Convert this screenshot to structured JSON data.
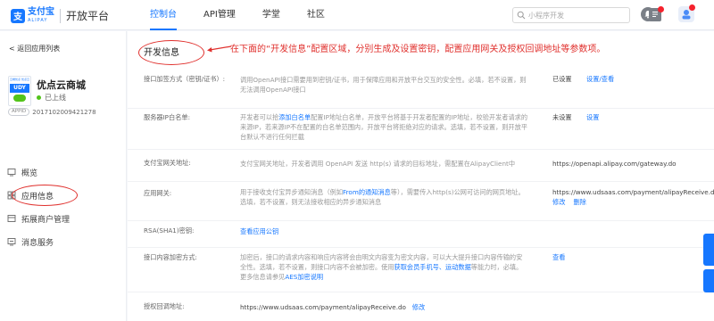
{
  "brand": {
    "mark": "支",
    "name_cn": "支付宝",
    "name_en": "ALIPAY",
    "platform": "开放平台"
  },
  "nav": {
    "items": [
      {
        "label": "控制台",
        "active": true
      },
      {
        "label": "API管理",
        "active": false
      },
      {
        "label": "学堂",
        "active": false
      },
      {
        "label": "社区",
        "active": false
      }
    ]
  },
  "search": {
    "placeholder": "小程序开发"
  },
  "sidebar": {
    "back_label": "< 返回应用列表",
    "app_logo_top_text": "云端优点 优点云",
    "app_logo_udy": "UDY",
    "app_name": "优点云商城",
    "app_status": "已上线",
    "appid_tag": "APPID",
    "appid": "2017102009421278",
    "menu": [
      {
        "label": "概览",
        "icon": "overview-icon"
      },
      {
        "label": "应用信息",
        "icon": "app-info-icon",
        "active": true
      },
      {
        "label": "拓展商户管理",
        "icon": "merchant-icon"
      },
      {
        "label": "消息服务",
        "icon": "message-icon"
      }
    ]
  },
  "main": {
    "section_title": "开发信息",
    "annotation": "在下面的“开发信息”配置区域，分别生成及设置密钥，配置应用网关及授权回调地址等参数项。",
    "rows": [
      {
        "label": "接口加签方式（密钥/证书）:",
        "desc": "调用OpenAPI接口需要用到密钥/证书，用于保障应用和开放平台交互的安全性。必填，若不设置，则无法调用OpenAPI接口",
        "status": "已设置",
        "action": "设置/查看"
      },
      {
        "label": "服务器IP白名单:",
        "desc_pre": "开发者可以拾",
        "desc_link": "添加白名单",
        "desc_post": "配置IP地址白名单，开放平台将基于开发者配置的IP地址，校验开发者请求的来源IP，若来源IP不在配置的白名单范围内，开放平台将拒绝对应的请求。选填，若不设置，则开放平台默认不进行任何拦截",
        "status": "未设置",
        "action": "设置"
      },
      {
        "label": "支付宝网关地址:",
        "desc": "支付宝网关地址，开发者调用 OpenAPI 发送 http(s) 请求的目标地址，需配置在AlipayClient中",
        "value": "https://openapi.alipay.com/gateway.do"
      },
      {
        "label": "应用网关:",
        "desc_pre": "用于接收支付宝异步通知消息（例如",
        "desc_link": "From的通知消息",
        "desc_post": "等），需要传入http(s)公网可访问的网页地址。选填，若不设置，则无法接收相应的异步通知消息",
        "value": "https://www.udsaas.com/payment/alipayReceive.do",
        "action_1": "修改",
        "action_2": "删除"
      },
      {
        "label": "RSA(SHA1)密钥:",
        "desc_link": "查看应用公钥"
      },
      {
        "label": "接口内容加密方式:",
        "desc_pre": "加密后，接口的请求内容和响应内容将会由明文内容变为密文内容，可以大大提升接口内容传输的安全性。选填，若不设置，则接口内容不会被加密。使用",
        "desc_link": "获取会员手机号、运动数据",
        "desc_post": "等能力时，必填。更多信息请参见",
        "desc_link2": "AES加密说明",
        "action": "查看"
      },
      {
        "label": "授权回调地址:",
        "value": "https://www.udsaas.com/payment/alipayReceive.do",
        "action": "修改"
      }
    ]
  },
  "colors": {
    "accent": "#1677ff",
    "annotation": "#e0302d",
    "success": "#52c41a"
  }
}
